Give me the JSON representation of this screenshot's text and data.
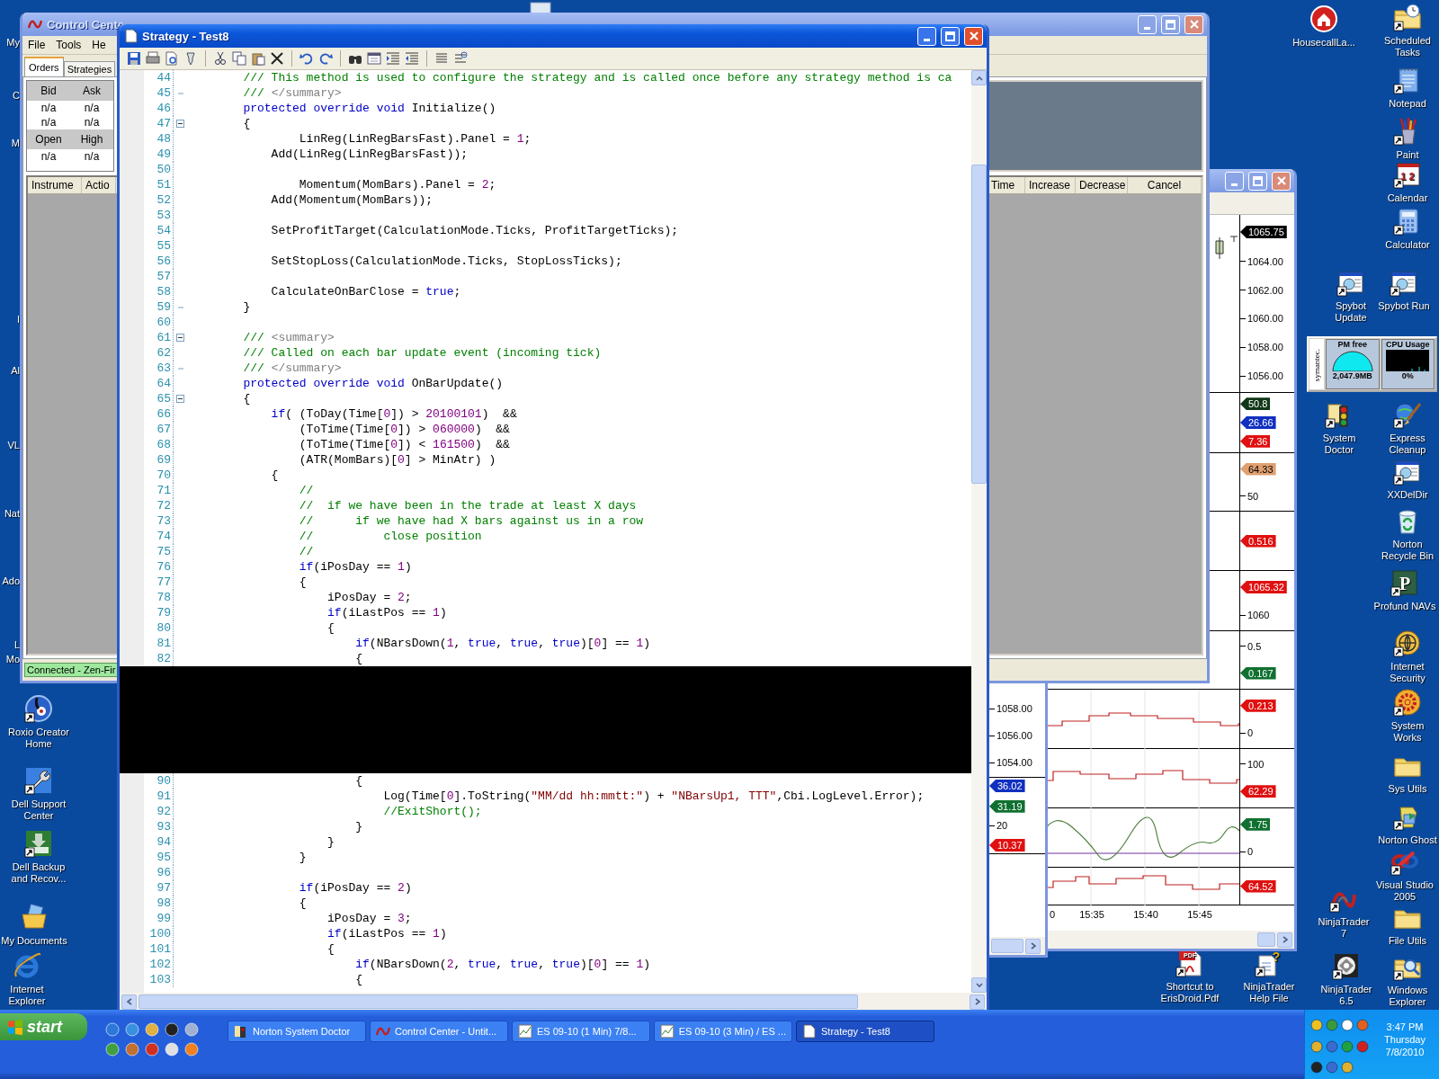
{
  "desktop": {
    "left_fragments": [
      "My",
      "C",
      "M",
      "I",
      "Al",
      "VL",
      "Nat",
      "Ado",
      "L",
      "Mo"
    ],
    "left_icons": [
      {
        "label": "Roxio Creator Home",
        "shortcut": true
      },
      {
        "label": "Dell Support Center",
        "shortcut": true
      },
      {
        "label": "Dell Backup and Recov...",
        "shortcut": true
      },
      {
        "label": "My Documents",
        "shortcut": false
      },
      {
        "label": "Internet Explorer",
        "shortcut": false
      }
    ],
    "right_icons": [
      {
        "label": "HousecallLa...",
        "shortcut": false
      },
      {
        "label": "Scheduled Tasks",
        "shortcut": true
      },
      {
        "label": "Notepad",
        "shortcut": true
      },
      {
        "label": "Paint",
        "shortcut": true
      },
      {
        "label": "Calendar",
        "shortcut": true,
        "glyph": "1 2"
      },
      {
        "label": "Calculator",
        "shortcut": true
      },
      {
        "label": "Spybot Update",
        "shortcut": true
      },
      {
        "label": "Spybot Run",
        "shortcut": true
      },
      {
        "label": "System Doctor",
        "shortcut": true
      },
      {
        "label": "Express Cleanup",
        "shortcut": true
      },
      {
        "label": "XXDelDir",
        "shortcut": true
      },
      {
        "label": "Norton Recycle Bin",
        "shortcut": false
      },
      {
        "label": "Profund NAVs",
        "shortcut": true,
        "glyph": "P"
      },
      {
        "label": "Internet Security",
        "shortcut": true
      },
      {
        "label": "System Works",
        "shortcut": true
      },
      {
        "label": "Sys Utils",
        "shortcut": false
      },
      {
        "label": "Norton Ghost",
        "shortcut": true
      },
      {
        "label": "Visual Studio 2005",
        "shortcut": true
      },
      {
        "label": "NinjaTrader 7",
        "shortcut": true
      },
      {
        "label": "File Utils",
        "shortcut": false
      },
      {
        "label": "Shortcut to ErisDroid.Pdf",
        "shortcut": true,
        "glyph": "PDF"
      },
      {
        "label": "NinjaTrader Help File",
        "shortcut": true,
        "glyph": "?"
      },
      {
        "label": "NinjaTrader 6.5",
        "shortcut": true
      },
      {
        "label": "Windows Explorer",
        "shortcut": true
      }
    ],
    "widget": {
      "brand": "symantec.",
      "memory_title": "PM free",
      "memory_reading": "2,047.9MB",
      "cpu_title": "CPU Usage",
      "cpu_reading": "0%"
    }
  },
  "control_center": {
    "title": "Control Cente",
    "menu": [
      "File",
      "Tools",
      "He"
    ],
    "tabs": [
      {
        "label": "Orders",
        "selected": true
      },
      {
        "label": "Strategies",
        "selected": false
      }
    ],
    "quotes": [
      {
        "header": [
          "Bid",
          "Ask"
        ],
        "rows": [
          [
            "n/a",
            "n/a"
          ],
          [
            "n/a",
            "n/a"
          ]
        ]
      },
      {
        "header": [
          "Open",
          "High"
        ],
        "rows": [
          [
            "n/a",
            "n/a"
          ]
        ]
      }
    ],
    "orders_left_columns": [
      "Instrume",
      "Actio"
    ],
    "orders_right_columns": [
      "Time",
      "Increase",
      "Decrease",
      "Cancel"
    ],
    "status": "Connected - Zen-Fir"
  },
  "chart_back": {
    "panels": [
      {
        "labels": [
          {
            "kind": "tick",
            "text": "1058.00"
          },
          {
            "kind": "tick",
            "text": "1056.00"
          },
          {
            "kind": "tick",
            "text": "1054.00"
          }
        ]
      },
      {
        "labels": [
          {
            "kind": "tag",
            "text": "36.02",
            "color": "#1030c0"
          },
          {
            "kind": "tag",
            "text": "31.19",
            "color": "#107030"
          },
          {
            "kind": "tick",
            "text": "20"
          },
          {
            "kind": "tag",
            "text": "10.37",
            "color": "#e01010"
          }
        ]
      }
    ]
  },
  "chart_front": {
    "panels": [
      {
        "labels": [
          {
            "kind": "tag",
            "text": "1065.75",
            "color": "#000000"
          },
          {
            "kind": "tick",
            "text": "1064.00"
          },
          {
            "kind": "tick",
            "text": "1062.00"
          },
          {
            "kind": "tick",
            "text": "1060.00"
          },
          {
            "kind": "tick",
            "text": "1058.00"
          },
          {
            "kind": "tick",
            "text": "1056.00"
          }
        ]
      },
      {
        "labels": [
          {
            "kind": "tag",
            "text": "50.8",
            "color": "#103818"
          },
          {
            "kind": "tag",
            "text": "26.66",
            "color": "#1030c0"
          },
          {
            "kind": "tag",
            "text": "7.36",
            "color": "#e01010"
          }
        ]
      },
      {
        "labels": [
          {
            "kind": "tag",
            "text": "64.33",
            "color": "#e0a070"
          },
          {
            "kind": "tick",
            "text": "50"
          }
        ]
      },
      {
        "labels": [
          {
            "kind": "tag",
            "text": "0.516",
            "color": "#e01010"
          }
        ]
      },
      {
        "labels": [
          {
            "kind": "tag",
            "text": "1065.32",
            "color": "#e01010"
          },
          {
            "kind": "tick",
            "text": "1060"
          }
        ]
      },
      {
        "labels": [
          {
            "kind": "tick",
            "text": "0.5"
          },
          {
            "kind": "tag",
            "text": "0.167",
            "color": "#107030"
          }
        ]
      },
      {
        "labels": [
          {
            "kind": "tag",
            "text": "0.213",
            "color": "#e01010"
          },
          {
            "kind": "tick",
            "text": "0"
          }
        ]
      },
      {
        "labels": [
          {
            "kind": "tick",
            "text": "100"
          },
          {
            "kind": "tag",
            "text": "62.29",
            "color": "#e01010"
          }
        ]
      },
      {
        "labels": [
          {
            "kind": "tag",
            "text": "1.75",
            "color": "#107030"
          },
          {
            "kind": "tick",
            "text": "0"
          }
        ]
      },
      {
        "labels": [
          {
            "kind": "tag",
            "text": "64.52",
            "color": "#e01010"
          }
        ]
      }
    ],
    "time_labels": [
      "0",
      "15:35",
      "15:40",
      "15:45"
    ]
  },
  "editor": {
    "title": "Strategy - Test8",
    "lines": [
      {
        "number": "44",
        "tokens": [
          {
            "kind": "comment",
            "text": "        /// This method is used to configure the strategy and is called once before any strategy method is ca"
          }
        ]
      },
      {
        "number": "45",
        "fold_end": true,
        "tokens": [
          {
            "kind": "comment",
            "text": "        /// "
          },
          {
            "kind": "doc",
            "text": "</summary>"
          }
        ]
      },
      {
        "number": "46",
        "tokens": [
          {
            "kind": "keyword",
            "text": "        protected override void"
          },
          {
            "kind": "plain",
            "text": " Initialize()"
          }
        ]
      },
      {
        "number": "47",
        "fold_toggle": true,
        "tokens": [
          {
            "kind": "plain",
            "text": "        {"
          }
        ]
      },
      {
        "number": "48",
        "tokens": [
          {
            "kind": "plain",
            "text": "                LinReg(LinRegBarsFast).Panel = "
          },
          {
            "kind": "number",
            "text": "1"
          },
          {
            "kind": "plain",
            "text": ";"
          }
        ]
      },
      {
        "number": "49",
        "tokens": [
          {
            "kind": "plain",
            "text": "            Add(LinReg(LinRegBarsFast));"
          }
        ]
      },
      {
        "number": "50"
      },
      {
        "number": "51",
        "tokens": [
          {
            "kind": "plain",
            "text": "                Momentum(MomBars).Panel = "
          },
          {
            "kind": "number",
            "text": "2"
          },
          {
            "kind": "plain",
            "text": ";"
          }
        ]
      },
      {
        "number": "52",
        "tokens": [
          {
            "kind": "plain",
            "text": "            Add(Momentum(MomBars));"
          }
        ]
      },
      {
        "number": "53"
      },
      {
        "number": "54",
        "tokens": [
          {
            "kind": "plain",
            "text": "            SetProfitTarget(CalculationMode.Ticks, ProfitTargetTicks);"
          }
        ]
      },
      {
        "number": "55"
      },
      {
        "number": "56",
        "tokens": [
          {
            "kind": "plain",
            "text": "            SetStopLoss(CalculationMode.Ticks, StopLossTicks);"
          }
        ]
      },
      {
        "number": "57"
      },
      {
        "number": "58",
        "tokens": [
          {
            "kind": "plain",
            "text": "            CalculateOnBarClose = "
          },
          {
            "kind": "keyword",
            "text": "true"
          },
          {
            "kind": "plain",
            "text": ";"
          }
        ]
      },
      {
        "number": "59",
        "fold_end": true,
        "tokens": [
          {
            "kind": "plain",
            "text": "        }"
          }
        ]
      },
      {
        "number": "60"
      },
      {
        "number": "61",
        "fold_toggle": true,
        "tokens": [
          {
            "kind": "comment",
            "text": "        /// "
          },
          {
            "kind": "doc",
            "text": "<summary>"
          }
        ]
      },
      {
        "number": "62",
        "tokens": [
          {
            "kind": "comment",
            "text": "        /// Called on each bar update event (incoming tick)"
          }
        ]
      },
      {
        "number": "63",
        "fold_end": true,
        "tokens": [
          {
            "kind": "comment",
            "text": "        /// "
          },
          {
            "kind": "doc",
            "text": "</summary>"
          }
        ]
      },
      {
        "number": "64",
        "tokens": [
          {
            "kind": "keyword",
            "text": "        protected override void"
          },
          {
            "kind": "plain",
            "text": " OnBarUpdate()"
          }
        ]
      },
      {
        "number": "65",
        "fold_toggle": true,
        "tokens": [
          {
            "kind": "plain",
            "text": "        {"
          }
        ]
      },
      {
        "number": "66",
        "tokens": [
          {
            "kind": "keyword",
            "text": "            if"
          },
          {
            "kind": "plain",
            "text": "( (ToDay(Time["
          },
          {
            "kind": "number",
            "text": "0"
          },
          {
            "kind": "plain",
            "text": "]) > "
          },
          {
            "kind": "number",
            "text": "20100101"
          },
          {
            "kind": "plain",
            "text": ")  &&"
          }
        ]
      },
      {
        "number": "67",
        "tokens": [
          {
            "kind": "plain",
            "text": "                (ToTime(Time["
          },
          {
            "kind": "number",
            "text": "0"
          },
          {
            "kind": "plain",
            "text": "]) > "
          },
          {
            "kind": "number",
            "text": "060000"
          },
          {
            "kind": "plain",
            "text": ")  &&"
          }
        ]
      },
      {
        "number": "68",
        "tokens": [
          {
            "kind": "plain",
            "text": "                (ToTime(Time["
          },
          {
            "kind": "number",
            "text": "0"
          },
          {
            "kind": "plain",
            "text": "]) < "
          },
          {
            "kind": "number",
            "text": "161500"
          },
          {
            "kind": "plain",
            "text": ")  &&"
          }
        ]
      },
      {
        "number": "69",
        "tokens": [
          {
            "kind": "plain",
            "text": "                (ATR(MomBars)["
          },
          {
            "kind": "number",
            "text": "0"
          },
          {
            "kind": "plain",
            "text": "] > MinAtr) )"
          }
        ]
      },
      {
        "number": "70",
        "tokens": [
          {
            "kind": "plain",
            "text": "            {"
          }
        ]
      },
      {
        "number": "71",
        "tokens": [
          {
            "kind": "comment",
            "text": "                //"
          }
        ]
      },
      {
        "number": "72",
        "tokens": [
          {
            "kind": "comment",
            "text": "                //  if we have been in the trade at least X days"
          }
        ]
      },
      {
        "number": "73",
        "tokens": [
          {
            "kind": "comment",
            "text": "                //      if we have had X bars against us in a row"
          }
        ]
      },
      {
        "number": "74",
        "tokens": [
          {
            "kind": "comment",
            "text": "                //          close position"
          }
        ]
      },
      {
        "number": "75",
        "tokens": [
          {
            "kind": "comment",
            "text": "                //"
          }
        ]
      },
      {
        "number": "76",
        "tokens": [
          {
            "kind": "keyword",
            "text": "                if"
          },
          {
            "kind": "plain",
            "text": "(iPosDay == "
          },
          {
            "kind": "number",
            "text": "1"
          },
          {
            "kind": "plain",
            "text": ")"
          }
        ]
      },
      {
        "number": "77",
        "tokens": [
          {
            "kind": "plain",
            "text": "                {"
          }
        ]
      },
      {
        "number": "78",
        "tokens": [
          {
            "kind": "plain",
            "text": "                    iPosDay = "
          },
          {
            "kind": "number",
            "text": "2"
          },
          {
            "kind": "plain",
            "text": ";"
          }
        ]
      },
      {
        "number": "79",
        "tokens": [
          {
            "kind": "keyword",
            "text": "                    if"
          },
          {
            "kind": "plain",
            "text": "(iLastPos == "
          },
          {
            "kind": "number",
            "text": "1"
          },
          {
            "kind": "plain",
            "text": ")"
          }
        ]
      },
      {
        "number": "80",
        "tokens": [
          {
            "kind": "plain",
            "text": "                    {"
          }
        ]
      },
      {
        "number": "81",
        "tokens": [
          {
            "kind": "keyword",
            "text": "                        if"
          },
          {
            "kind": "plain",
            "text": "(NBarsDown("
          },
          {
            "kind": "number",
            "text": "1"
          },
          {
            "kind": "plain",
            "text": ", "
          },
          {
            "kind": "keyword",
            "text": "true"
          },
          {
            "kind": "plain",
            "text": ", "
          },
          {
            "kind": "keyword",
            "text": "true"
          },
          {
            "kind": "plain",
            "text": ", "
          },
          {
            "kind": "keyword",
            "text": "true"
          },
          {
            "kind": "plain",
            "text": ")["
          },
          {
            "kind": "number",
            "text": "0"
          },
          {
            "kind": "plain",
            "text": "] == "
          },
          {
            "kind": "number",
            "text": "1"
          },
          {
            "kind": "plain",
            "text": ")"
          }
        ]
      },
      {
        "number": "82",
        "tokens": [
          {
            "kind": "plain",
            "text": "                        {"
          }
        ]
      },
      {
        "kind": "redacted"
      },
      {
        "number": "90",
        "tokens": [
          {
            "kind": "plain",
            "text": "                        {"
          }
        ]
      },
      {
        "number": "91",
        "tokens": [
          {
            "kind": "plain",
            "text": "                            Log(Time["
          },
          {
            "kind": "number",
            "text": "0"
          },
          {
            "kind": "plain",
            "text": "].ToString("
          },
          {
            "kind": "string",
            "text": "\"MM/dd hh:mmtt:\""
          },
          {
            "kind": "plain",
            "text": ") + "
          },
          {
            "kind": "string",
            "text": "\"NBarsUp1, TTT\""
          },
          {
            "kind": "plain",
            "text": ",Cbi.LogLevel.Error);"
          }
        ]
      },
      {
        "number": "92",
        "tokens": [
          {
            "kind": "comment",
            "text": "                            //ExitShort();"
          }
        ]
      },
      {
        "number": "93",
        "tokens": [
          {
            "kind": "plain",
            "text": "                        }"
          }
        ]
      },
      {
        "number": "94",
        "tokens": [
          {
            "kind": "plain",
            "text": "                    }"
          }
        ]
      },
      {
        "number": "95",
        "tokens": [
          {
            "kind": "plain",
            "text": "                }"
          }
        ]
      },
      {
        "number": "96"
      },
      {
        "number": "97",
        "tokens": [
          {
            "kind": "keyword",
            "text": "                if"
          },
          {
            "kind": "plain",
            "text": "(iPosDay == "
          },
          {
            "kind": "number",
            "text": "2"
          },
          {
            "kind": "plain",
            "text": ")"
          }
        ]
      },
      {
        "number": "98",
        "tokens": [
          {
            "kind": "plain",
            "text": "                {"
          }
        ]
      },
      {
        "number": "99",
        "tokens": [
          {
            "kind": "plain",
            "text": "                    iPosDay = "
          },
          {
            "kind": "number",
            "text": "3"
          },
          {
            "kind": "plain",
            "text": ";"
          }
        ]
      },
      {
        "number": "100",
        "tokens": [
          {
            "kind": "keyword",
            "text": "                    if"
          },
          {
            "kind": "plain",
            "text": "(iLastPos == "
          },
          {
            "kind": "number",
            "text": "1"
          },
          {
            "kind": "plain",
            "text": ")"
          }
        ]
      },
      {
        "number": "101",
        "tokens": [
          {
            "kind": "plain",
            "text": "                    {"
          }
        ]
      },
      {
        "number": "102",
        "tokens": [
          {
            "kind": "keyword",
            "text": "                        if"
          },
          {
            "kind": "plain",
            "text": "(NBarsDown("
          },
          {
            "kind": "number",
            "text": "2"
          },
          {
            "kind": "plain",
            "text": ", "
          },
          {
            "kind": "keyword",
            "text": "true"
          },
          {
            "kind": "plain",
            "text": ", "
          },
          {
            "kind": "keyword",
            "text": "true"
          },
          {
            "kind": "plain",
            "text": ", "
          },
          {
            "kind": "keyword",
            "text": "true"
          },
          {
            "kind": "plain",
            "text": ")["
          },
          {
            "kind": "number",
            "text": "0"
          },
          {
            "kind": "plain",
            "text": "] == "
          },
          {
            "kind": "number",
            "text": "1"
          },
          {
            "kind": "plain",
            "text": ")"
          }
        ]
      },
      {
        "number": "103",
        "tokens": [
          {
            "kind": "plain",
            "text": "                        {"
          }
        ]
      }
    ]
  },
  "taskbar": {
    "start": "start",
    "tasks": [
      {
        "label": "Norton System Doctor",
        "selected": false
      },
      {
        "label": "Control Center - Untit...",
        "selected": false
      },
      {
        "label": "ES 09-10 (1 Min)  7/8...",
        "selected": false
      },
      {
        "label": "ES 09-10 (3 Min) / ES ...",
        "selected": false
      },
      {
        "label": "Strategy - Test8",
        "selected": true
      }
    ],
    "clock": {
      "time": "3:47 PM",
      "day": "Thursday",
      "date": "7/8/2010"
    }
  }
}
